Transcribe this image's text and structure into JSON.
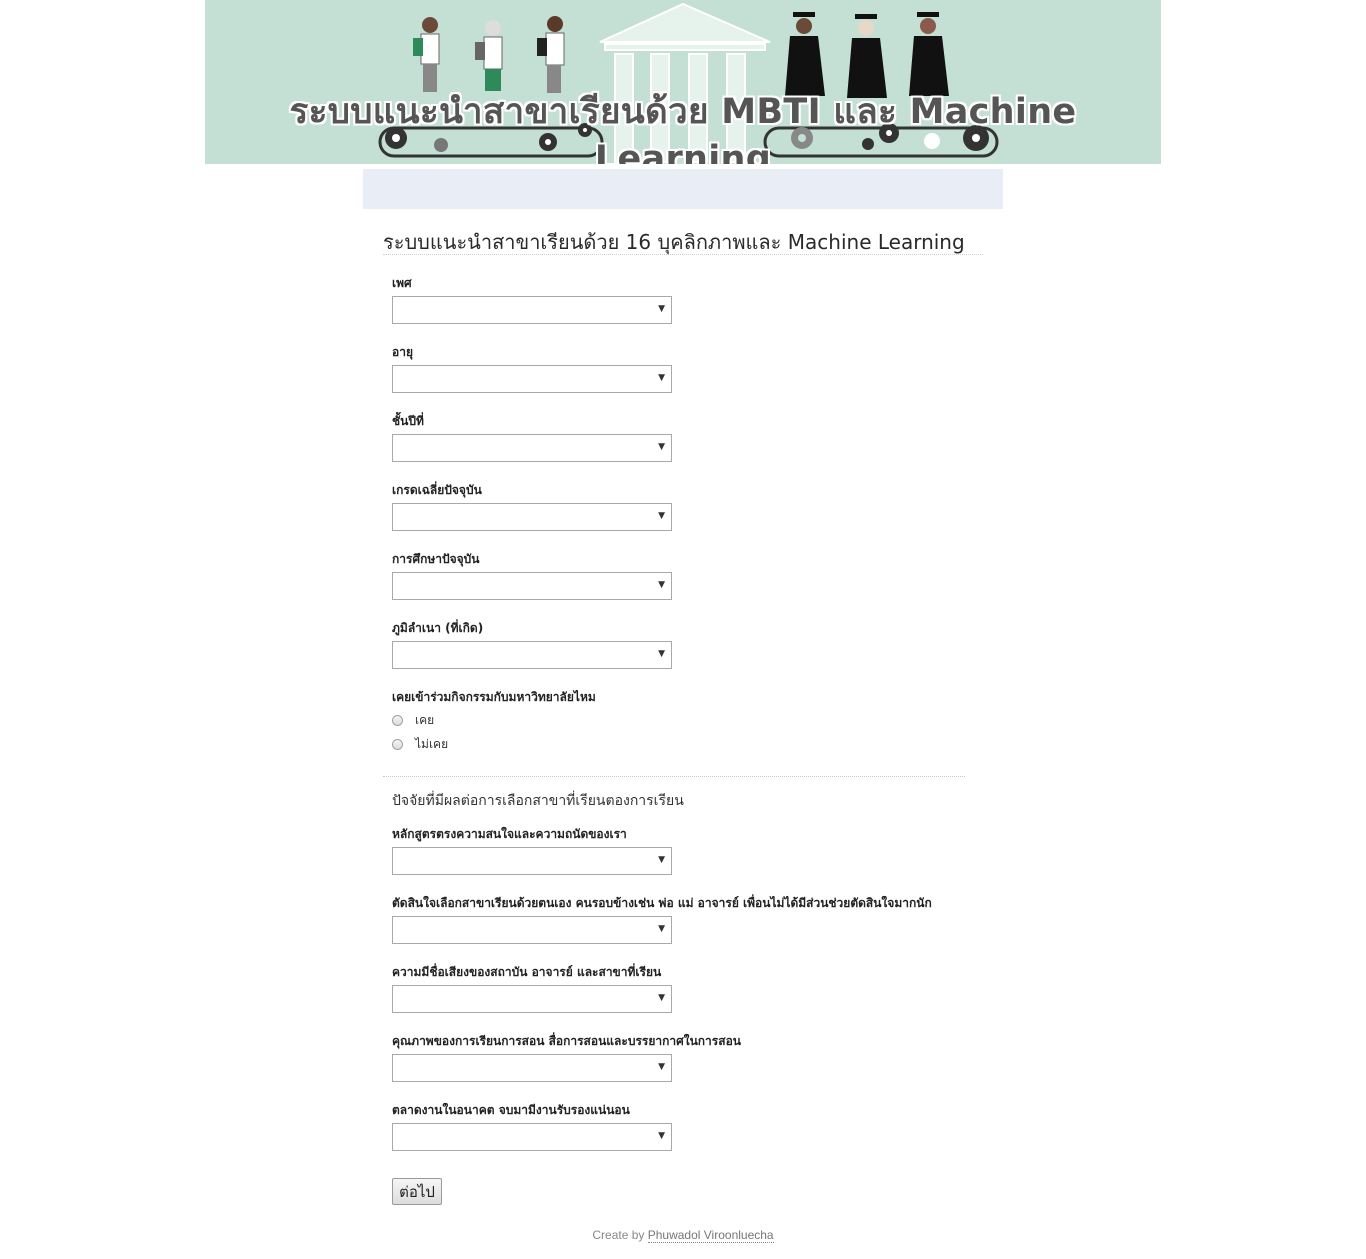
{
  "banner": {
    "title": "ระบบแนะนำสาขาเรียนด้วย MBTI และ Machine Learning",
    "background_color": "#c4dfd4"
  },
  "form": {
    "title": "ระบบแนะนำสาขาเรียนด้วย 16 บุคลิกภาพและ Machine Learning",
    "fields": [
      {
        "label": "เพศ",
        "value": ""
      },
      {
        "label": "อายุ",
        "value": ""
      },
      {
        "label": "ชั้นปีที่",
        "value": ""
      },
      {
        "label": "เกรดเฉลี่ยปัจจุบัน",
        "value": ""
      },
      {
        "label": "การศึกษาปัจจุบัน",
        "value": ""
      },
      {
        "label": "ภูมิลำเนา (ที่เกิด)",
        "value": ""
      }
    ],
    "activity_question": {
      "label": "เคยเข้าร่วมกิจกรรมกับมหาวิทยาลัยไหม",
      "options": [
        "เคย",
        "ไม่เคย"
      ]
    },
    "factors": {
      "heading": "ปัจจัยที่มีผลต่อการเลือกสาขาที่เรียนตองการเรียน",
      "fields": [
        {
          "label": "หลักสูตรตรงความสนใจและความถนัดของเรา",
          "value": ""
        },
        {
          "label": "ตัดสินใจเลือกสาขาเรียนด้วยตนเอง คนรอบข้างเช่น พ่อ แม่ อาจารย์ เพื่อนไม่ได้มีส่วนช่วยตัดสินใจมากนัก",
          "value": ""
        },
        {
          "label": "ความมีชื่อเสียงของสถาบัน อาจารย์ และสาขาที่เรียน",
          "value": ""
        },
        {
          "label": "คุณภาพของการเรียนการสอน สื่อการสอนและบรรยากาศในการสอน",
          "value": ""
        },
        {
          "label": "ตลาดงานในอนาคต จบมามีงานรับรองแน่นอน",
          "value": ""
        }
      ]
    },
    "next_label": "ต่อไป",
    "dropdown_icon": "caret-down-icon"
  },
  "footer": {
    "prefix": "Create by ",
    "author": "Phuwadol Viroonluecha"
  }
}
